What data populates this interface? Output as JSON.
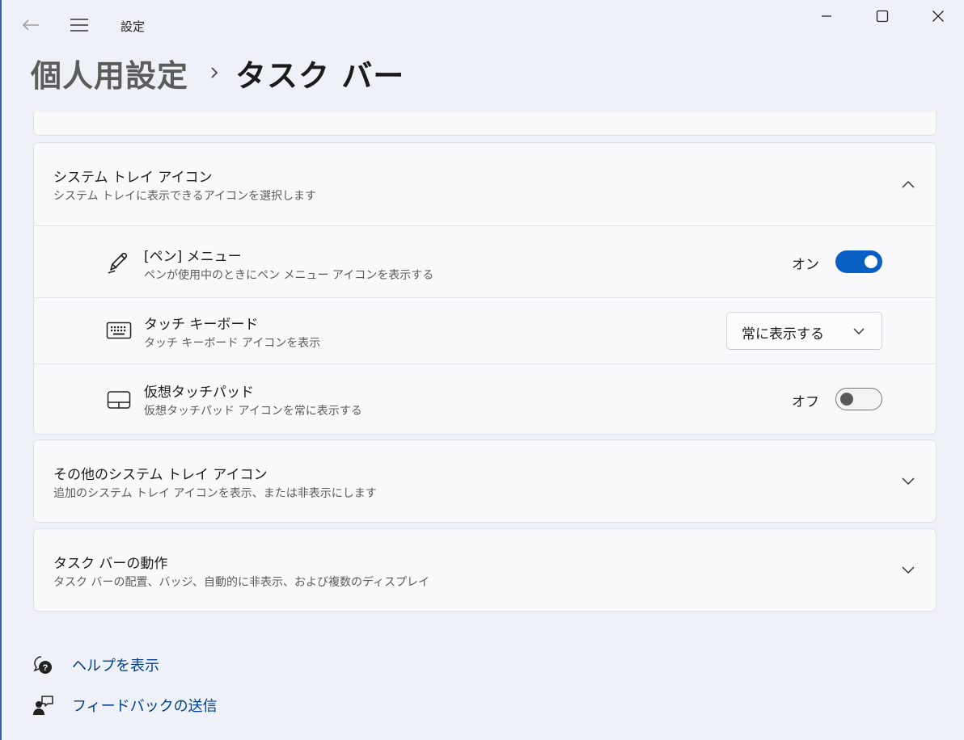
{
  "window": {
    "app_title": "設定"
  },
  "breadcrumb": {
    "parent": "個人用設定",
    "current": "タスク バー"
  },
  "system_tray": {
    "title": "システム トレイ アイコン",
    "subtitle": "システム トレイに表示できるアイコンを選択します",
    "items": [
      {
        "title": "[ペン] メニュー",
        "subtitle": "ペンが使用中のときにペン メニュー アイコンを表示する",
        "state_label": "オン",
        "state": "on",
        "icon": "pen-icon"
      },
      {
        "title": "タッチ キーボード",
        "subtitle": "タッチ キーボード アイコンを表示",
        "dropdown_value": "常に表示する",
        "icon": "keyboard-icon"
      },
      {
        "title": "仮想タッチパッド",
        "subtitle": "仮想タッチパッド アイコンを常に表示する",
        "state_label": "オフ",
        "state": "off",
        "icon": "touchpad-icon"
      }
    ]
  },
  "other_tray": {
    "title": "その他のシステム トレイ アイコン",
    "subtitle": "追加のシステム トレイ アイコンを表示、または非表示にします"
  },
  "taskbar_behavior": {
    "title": "タスク バーの動作",
    "subtitle": "タスク バーの配置、バッジ、自動的に非表示、および複数のディスプレイ"
  },
  "links": {
    "help": "ヘルプを表示",
    "feedback": "フィードバックの送信"
  },
  "colors": {
    "accent": "#0a5fc4",
    "link": "#003e92",
    "background": "#eef1f7",
    "card": "#f9f9fb"
  }
}
